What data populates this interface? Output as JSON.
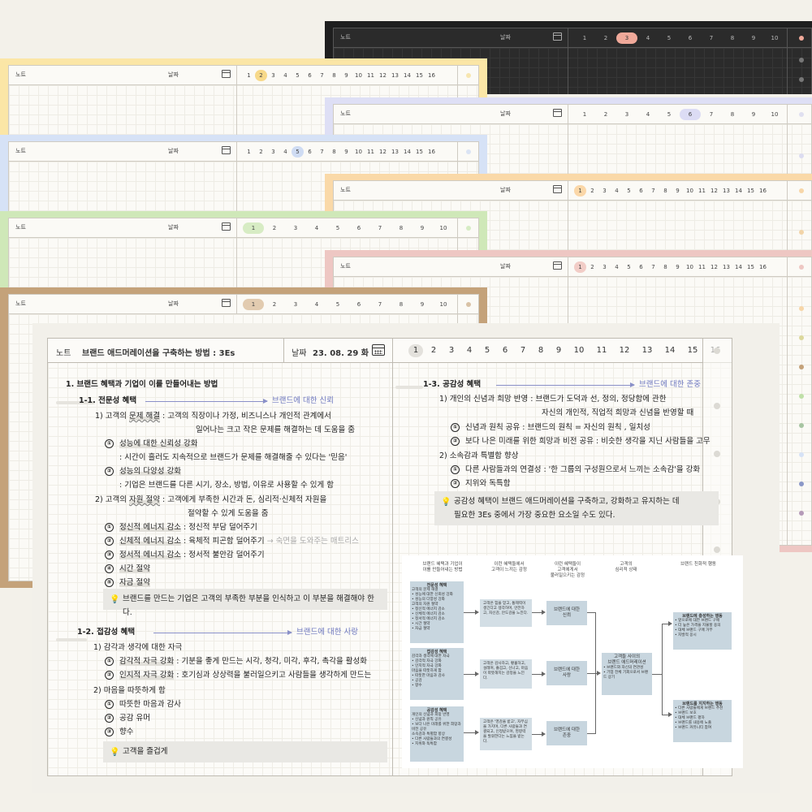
{
  "header": {
    "note_label": "노트",
    "date_label": "날짜"
  },
  "back_pages": {
    "days_16": [
      "1",
      "2",
      "3",
      "4",
      "5",
      "6",
      "7",
      "8",
      "9",
      "10",
      "11",
      "12",
      "13",
      "14",
      "15",
      "16"
    ],
    "days_10": [
      "1",
      "2",
      "3",
      "4",
      "5",
      "6",
      "7",
      "8",
      "9",
      "10"
    ]
  },
  "main": {
    "note_label": "노트",
    "title": "브랜드 애드머레이션을 구축하는 방법 : 3Es",
    "date_label": "날짜",
    "date_value": "23. 08. 29 화",
    "days": [
      "1",
      "2",
      "3",
      "4",
      "5",
      "6",
      "7",
      "8",
      "9",
      "10",
      "11",
      "12",
      "13",
      "14",
      "15",
      "16"
    ],
    "selected_day": "1",
    "left": {
      "l1": "1. 브랜드 혜택과 기업이 이를 만들어내는 방법",
      "l2": "1-1. 전문성 혜택",
      "l2_arrow": "브랜드에 대한 신뢰",
      "l3a": "1) 고객의 ",
      "l3b": "문제 해결",
      "l3c": " : 고객의 직장이나 가정, 비즈니스나 개인적 관계에서",
      "l4": "일어나는 크고 작은 문제를 해결하는 데 도움을 줌",
      "l5": "성능에 대한 신뢰성 강화",
      "l6": ": 시간이 흘러도 지속적으로 브랜드가 문제를 해결해줄 수 있다는 '믿음'",
      "l7": "성능의 다양성 강화",
      "l8": ": 기업은 브랜드를 다른 시기, 장소, 방법, 이유로 사용할 수 있게 함",
      "l9a": "2) 고객의 ",
      "l9b": "자원 절약",
      "l9c": " : 고객에게 부족한 시간과 돈, 심리적·신체적 자원을",
      "l10": "절약할 수 있게 도움을 줌",
      "l11a": "정신적 에너지 감소",
      "l11b": " : 정신적 부담 덜어주기",
      "l12a": "신체적 에너지 감소",
      "l12b": " : 육체적 피곤함 덜어주기",
      "l12c": "→ 숙면을 도와주는 매트리스",
      "l13a": "정서적 에너지 감소",
      "l13b": " : 정서적 불안감 덜어주기",
      "l14": "시간 절약",
      "l15": "자금 절약",
      "note1": "브랜드를 만드는 기업은 고객의 부족한 부분을 인식하고 이 부분을 해결해야 한다.",
      "l16": "1-2. 접감성 혜택",
      "l16_arrow": "브랜드에 대한 사랑",
      "l17": "1) 감각과 생각에 대한 자극",
      "l18a": "감각적 자극 강화",
      "l18b": " : 기분을 좋게 만드는 시각, 청각, 미각, 후각, 촉각을 활성화",
      "l19a": "인지적 자극 강화",
      "l19b": " : 호기심과 상상력을 불러일으키고 사람들을 생각하게 만드는",
      "l20": "2) 마음을 따뜻하게 함",
      "l21": "따뜻한 마음과 감사",
      "l22": "공감  유머",
      "l23": "향수",
      "note2": "고객을 즐겁게"
    },
    "right": {
      "r1": "1-3. 공감성 혜택",
      "r1_arrow": "브랜드에 대한 존중",
      "r2": "1) 개인의 신념과 희망 반영 : 브랜드가 도덕과 선, 정의, 정당함에 관한",
      "r3": "자신의 개인적, 직업적 희망과 신념을 반영할 때",
      "r4": "신념과 원칙 공유  : 브랜드의 원칙 = 자신의 원칙 , 일치성",
      "r5": "보다 나은 미래를 위한 희망과 비전 공유 : 비슷한 생각을 지닌 사람들을 고무",
      "r6": "2) 소속감과 특별함 향상",
      "r7": "다른 사람들과의 연결성 : '한 그룹의 구성원으로서 느끼는 소속감'을 강화",
      "r8": "지위와 독특함",
      "note1": "공감성 혜택이 브랜드 애드머레이션을 구축하고, 강화하고 유지하는 데",
      "note2": "필요한 3Es 중에서 가장 중요한 요소일 수도 있다."
    },
    "circled": [
      "①",
      "②",
      "③",
      "④",
      "⑤"
    ]
  },
  "diagram": {
    "col1": "브랜드 혜택과 기업이\n이를 만들어내는 방법",
    "col2": "이런 혜택들에서\n고객이 느끼는 감정",
    "col3": "이런 혜택들이\n고객에게서\n불러일으키는 감정",
    "col4": "고객의\n심리적 상태",
    "col5": "브랜드 친화적 행동",
    "b1_title": "전문성 혜택",
    "b1_lines": [
      "고객의 문제 해결",
      "• 성능에 대한 신뢰성 강화",
      "• 성능의 다양성 강화",
      "고객의 자원 절약",
      "• 정신적 에너지 감소",
      "• 신체적 에너지 감소",
      "• 정서적 에너지 감소",
      "• 시간 절약",
      "• 자금 절약"
    ],
    "b2_title": "접감성 혜택",
    "b2_lines": [
      "감각과 생각에 대한 자극",
      "• 감각적 자극 강화",
      "• 인지적 자극 강화",
      "마음을 따뜻하게 함",
      "• 따뜻한 마음과 감사",
      "• 공감",
      "• 향수"
    ],
    "b3_title": "공감성 혜택",
    "b3_lines": [
      "개인의 신념과 희망 반영",
      "• 신념과 원칙 공유",
      "• 보다 나은 미래를 위한 희망과 비전 공유",
      "소속감과 특별함 향상",
      "• 다른 사람들과의 연결성",
      "• 지위와 독특함"
    ],
    "c1": "고객은 힘을 얻고, 통제력이 생긴다고 생각하며, 안전하고, 자신감, 안도감을 느낀다.",
    "c2": "고객은 감사하고, 황홀하고, 설레며, 즐겁고, 신나고, 마음이 따뜻해지는 감정을 느낀다.",
    "c3": "고객은 '영감을 받고', 자부심을 가지며, 다른 사람들과 연결되고, 인정받으며, 영향력을 발휘한다는 느낌을 받는다.",
    "e1": "브랜드에 대한\n신뢰",
    "e2": "브랜드에 대한\n사랑",
    "e3": "브랜드에 대한\n존중",
    "center_title": "고객들 사이의\n브랜드 애드머레이션",
    "center_lines": [
      "• 브랜드와 자신의 연관성",
      "• 기업 전체 기회으로서 브랜드 상기"
    ],
    "out1_title": "브랜드에 충성하는 행동",
    "out1_lines": [
      "• 앞으로에 대한 브랜드 구매",
      "• 더 높은 가격을 지불할 용의",
      "• 대체 브랜드 구매 거부",
      "• 자발적 옹시"
    ],
    "out2_title": "브랜드를 지지하는 행동",
    "out2_lines": [
      "• 다른 사람들에게 브랜드 추천",
      "• 브랜드 보호",
      "• 대체 브랜드 평하",
      "• 브랜드를 내용에 노출",
      "• 브랜드 커뮤니티 참여"
    ]
  },
  "colors": {
    "yellow": "#fbe6a6",
    "blue": "#d6e2f6",
    "green": "#cfe8b8",
    "kraft": "#c4a27a",
    "dark": "#1f1f1f",
    "lavender": "#dedff5",
    "peach": "#fad9a8",
    "pink": "#eec7c3"
  }
}
